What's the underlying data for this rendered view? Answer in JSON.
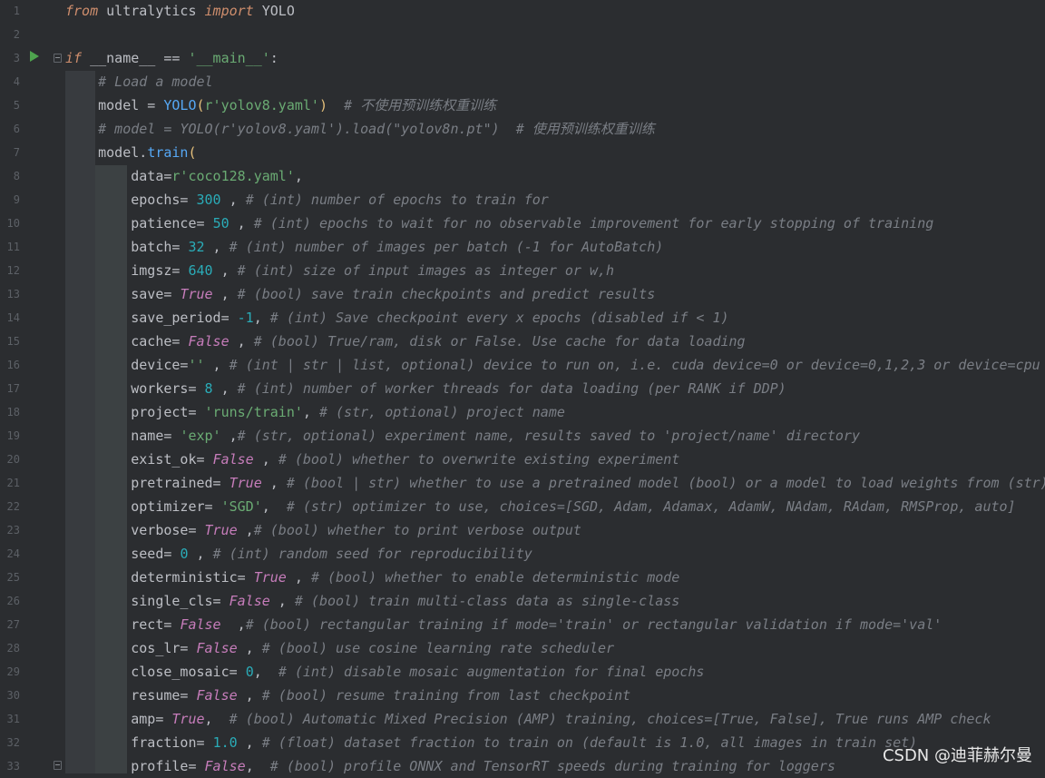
{
  "editor": {
    "line_numbers": [
      "1",
      "2",
      "3",
      "4",
      "5",
      "6",
      "7",
      "8",
      "9",
      "10",
      "11",
      "12",
      "13",
      "14",
      "15",
      "16",
      "17",
      "18",
      "19",
      "20",
      "21",
      "22",
      "23",
      "24",
      "25",
      "26",
      "27",
      "28",
      "29",
      "30",
      "31",
      "32",
      "33"
    ],
    "lines": [
      [
        {
          "t": "from",
          "c": "kw"
        },
        {
          "t": " ultralytics ",
          "c": "plain"
        },
        {
          "t": "import",
          "c": "kw"
        },
        {
          "t": " YOLO",
          "c": "plain"
        }
      ],
      [],
      [
        {
          "t": "if",
          "c": "kw"
        },
        {
          "t": " __name__ == ",
          "c": "plain"
        },
        {
          "t": "'__main__'",
          "c": "str"
        },
        {
          "t": ":",
          "c": "plain"
        }
      ],
      [
        {
          "t": "    ",
          "c": "plain"
        },
        {
          "t": "# Load a model",
          "c": "cm"
        }
      ],
      [
        {
          "t": "    model = ",
          "c": "plain"
        },
        {
          "t": "YOLO",
          "c": "cls"
        },
        {
          "t": "(",
          "c": "paren"
        },
        {
          "t": "r'yolov8.yaml'",
          "c": "str"
        },
        {
          "t": ")",
          "c": "paren"
        },
        {
          "t": "  ",
          "c": "plain"
        },
        {
          "t": "# 不使用预训练权重训练",
          "c": "cm"
        }
      ],
      [
        {
          "t": "    ",
          "c": "plain"
        },
        {
          "t": "# model = YOLO(r'yolov8.yaml').load(\"yolov8n.pt\")  # 使用预训练权重训练",
          "c": "cm"
        }
      ],
      [
        {
          "t": "    model.",
          "c": "plain"
        },
        {
          "t": "train",
          "c": "fn"
        },
        {
          "t": "(",
          "c": "paren"
        }
      ],
      [
        {
          "t": "        data=",
          "c": "plain"
        },
        {
          "t": "r'coco128.yaml'",
          "c": "str"
        },
        {
          "t": ",",
          "c": "plain"
        }
      ],
      [
        {
          "t": "        epochs= ",
          "c": "plain"
        },
        {
          "t": "300",
          "c": "num"
        },
        {
          "t": " , ",
          "c": "plain"
        },
        {
          "t": "# (int) number of epochs to train for",
          "c": "cm"
        }
      ],
      [
        {
          "t": "        patience= ",
          "c": "plain"
        },
        {
          "t": "50",
          "c": "num"
        },
        {
          "t": " , ",
          "c": "plain"
        },
        {
          "t": "# (int) epochs to wait for no observable improvement for early stopping of training",
          "c": "cm"
        }
      ],
      [
        {
          "t": "        batch= ",
          "c": "plain"
        },
        {
          "t": "32",
          "c": "num"
        },
        {
          "t": " , ",
          "c": "plain"
        },
        {
          "t": "# (int) number of images per batch (-1 for AutoBatch)",
          "c": "cm"
        }
      ],
      [
        {
          "t": "        imgsz= ",
          "c": "plain"
        },
        {
          "t": "640",
          "c": "num"
        },
        {
          "t": " , ",
          "c": "plain"
        },
        {
          "t": "# (int) size of input images as integer or w,h",
          "c": "cm"
        }
      ],
      [
        {
          "t": "        save= ",
          "c": "plain"
        },
        {
          "t": "True",
          "c": "bi"
        },
        {
          "t": " , ",
          "c": "plain"
        },
        {
          "t": "# (bool) save train checkpoints and predict results",
          "c": "cm"
        }
      ],
      [
        {
          "t": "        save_period= ",
          "c": "plain"
        },
        {
          "t": "-1",
          "c": "num"
        },
        {
          "t": ", ",
          "c": "plain"
        },
        {
          "t": "# (int) Save checkpoint every x epochs (disabled if < 1)",
          "c": "cm"
        }
      ],
      [
        {
          "t": "        cache= ",
          "c": "plain"
        },
        {
          "t": "False",
          "c": "bi"
        },
        {
          "t": " , ",
          "c": "plain"
        },
        {
          "t": "# (bool) True/ram, disk or False. Use cache for data loading",
          "c": "cm"
        }
      ],
      [
        {
          "t": "        device=",
          "c": "plain"
        },
        {
          "t": "''",
          "c": "str"
        },
        {
          "t": " , ",
          "c": "plain"
        },
        {
          "t": "# (int | str | list, optional) device to run on, i.e. cuda device=0 or device=0,1,2,3 or device=cpu",
          "c": "cm"
        }
      ],
      [
        {
          "t": "        workers= ",
          "c": "plain"
        },
        {
          "t": "8",
          "c": "num"
        },
        {
          "t": " , ",
          "c": "plain"
        },
        {
          "t": "# (int) number of worker threads for data loading (per RANK if DDP)",
          "c": "cm"
        }
      ],
      [
        {
          "t": "        project= ",
          "c": "plain"
        },
        {
          "t": "'runs/train'",
          "c": "str"
        },
        {
          "t": ", ",
          "c": "plain"
        },
        {
          "t": "# (str, optional) project name",
          "c": "cm"
        }
      ],
      [
        {
          "t": "        name= ",
          "c": "plain"
        },
        {
          "t": "'exp'",
          "c": "str"
        },
        {
          "t": " ,",
          "c": "plain"
        },
        {
          "t": "# (str, optional) experiment name, results saved to 'project/name' directory",
          "c": "cm"
        }
      ],
      [
        {
          "t": "        exist_ok= ",
          "c": "plain"
        },
        {
          "t": "False",
          "c": "bi"
        },
        {
          "t": " , ",
          "c": "plain"
        },
        {
          "t": "# (bool) whether to overwrite existing experiment",
          "c": "cm"
        }
      ],
      [
        {
          "t": "        pretrained= ",
          "c": "plain"
        },
        {
          "t": "True",
          "c": "bi"
        },
        {
          "t": " , ",
          "c": "plain"
        },
        {
          "t": "# (bool | str) whether to use a pretrained model (bool) or a model to load weights from (str)",
          "c": "cm"
        }
      ],
      [
        {
          "t": "        optimizer= ",
          "c": "plain"
        },
        {
          "t": "'SGD'",
          "c": "str"
        },
        {
          "t": ",  ",
          "c": "plain"
        },
        {
          "t": "# (str) optimizer to use, choices=[SGD, Adam, Adamax, AdamW, NAdam, RAdam, RMSProp, auto]",
          "c": "cm"
        }
      ],
      [
        {
          "t": "        verbose= ",
          "c": "plain"
        },
        {
          "t": "True",
          "c": "bi"
        },
        {
          "t": " ,",
          "c": "plain"
        },
        {
          "t": "# (bool) whether to print verbose output",
          "c": "cm"
        }
      ],
      [
        {
          "t": "        seed= ",
          "c": "plain"
        },
        {
          "t": "0",
          "c": "num"
        },
        {
          "t": " , ",
          "c": "plain"
        },
        {
          "t": "# (int) random seed for reproducibility",
          "c": "cm"
        }
      ],
      [
        {
          "t": "        deterministic= ",
          "c": "plain"
        },
        {
          "t": "True",
          "c": "bi"
        },
        {
          "t": " , ",
          "c": "plain"
        },
        {
          "t": "# (bool) whether to enable deterministic mode",
          "c": "cm"
        }
      ],
      [
        {
          "t": "        single_cls= ",
          "c": "plain"
        },
        {
          "t": "False",
          "c": "bi"
        },
        {
          "t": " , ",
          "c": "plain"
        },
        {
          "t": "# (bool) train multi-class data as single-class",
          "c": "cm"
        }
      ],
      [
        {
          "t": "        rect= ",
          "c": "plain"
        },
        {
          "t": "False",
          "c": "bi"
        },
        {
          "t": "  ,",
          "c": "plain"
        },
        {
          "t": "# (bool) rectangular training if mode='train' or rectangular validation if mode='val'",
          "c": "cm"
        }
      ],
      [
        {
          "t": "        cos_lr= ",
          "c": "plain"
        },
        {
          "t": "False",
          "c": "bi"
        },
        {
          "t": " , ",
          "c": "plain"
        },
        {
          "t": "# (bool) use cosine learning rate scheduler",
          "c": "cm"
        }
      ],
      [
        {
          "t": "        close_mosaic= ",
          "c": "plain"
        },
        {
          "t": "0",
          "c": "num"
        },
        {
          "t": ",  ",
          "c": "plain"
        },
        {
          "t": "# (int) disable mosaic augmentation for final epochs",
          "c": "cm"
        }
      ],
      [
        {
          "t": "        resume= ",
          "c": "plain"
        },
        {
          "t": "False",
          "c": "bi"
        },
        {
          "t": " , ",
          "c": "plain"
        },
        {
          "t": "# (bool) resume training from last checkpoint",
          "c": "cm"
        }
      ],
      [
        {
          "t": "        amp= ",
          "c": "plain"
        },
        {
          "t": "True",
          "c": "bi"
        },
        {
          "t": ",  ",
          "c": "plain"
        },
        {
          "t": "# (bool) Automatic Mixed Precision (AMP) training, choices=[True, False], True runs AMP check",
          "c": "cm"
        }
      ],
      [
        {
          "t": "        fraction= ",
          "c": "plain"
        },
        {
          "t": "1.0",
          "c": "num"
        },
        {
          "t": " , ",
          "c": "plain"
        },
        {
          "t": "# (float) dataset fraction to train on (default is 1.0, all images in train set)",
          "c": "cm"
        }
      ],
      [
        {
          "t": "        profile= ",
          "c": "plain"
        },
        {
          "t": "False",
          "c": "bi"
        },
        {
          "t": ",  ",
          "c": "plain"
        },
        {
          "t": "# (bool) profile ONNX and TensorRT speeds during training for loggers",
          "c": "cm"
        }
      ]
    ]
  },
  "watermark": "CSDN @迪菲赫尔曼",
  "colors": {
    "background": "#2b2d30",
    "keyword": "#cf8e6d",
    "string": "#6aab73",
    "number": "#2aacb8",
    "builtin": "#c77dbb",
    "function": "#56a8f5",
    "comment": "#7a7e85"
  },
  "icons": [
    "run-icon",
    "fold-icon"
  ]
}
